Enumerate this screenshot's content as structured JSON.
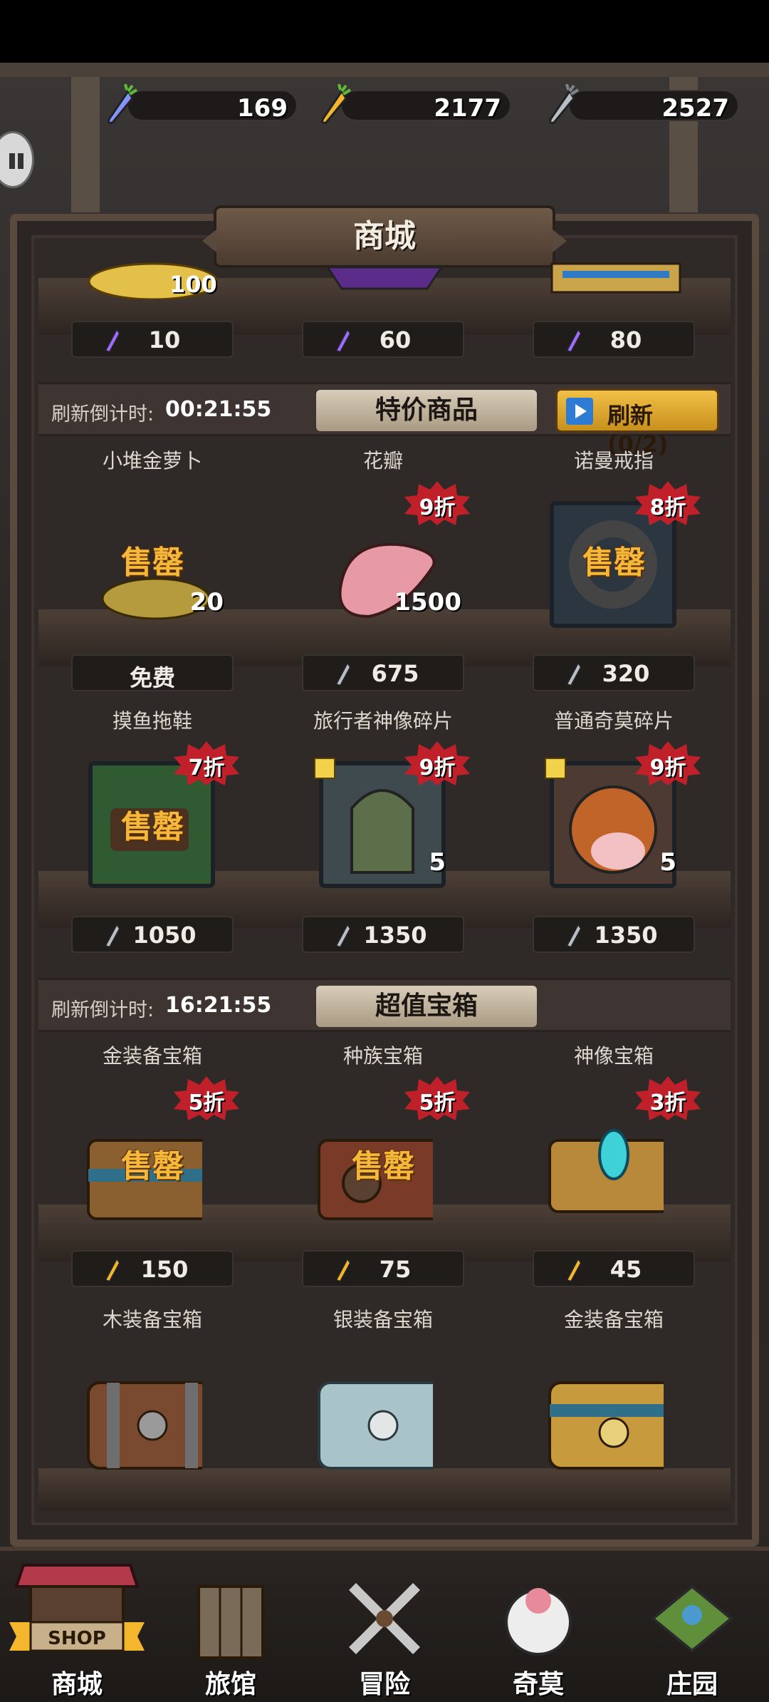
{
  "currencies": [
    {
      "name": "rainbow-carrot",
      "value": "169"
    },
    {
      "name": "gold-carrot",
      "value": "2177"
    },
    {
      "name": "silver-carrot",
      "value": "2527"
    }
  ],
  "page_title": "商城",
  "top_row_prices": [
    {
      "currency": "rainbow-carrot",
      "price": "10",
      "count": "100"
    },
    {
      "currency": "rainbow-carrot",
      "price": "60"
    },
    {
      "currency": "rainbow-carrot",
      "price": "80"
    }
  ],
  "special": {
    "timer_label": "刷新倒计时:",
    "timer": "00:21:55",
    "title": "特价商品",
    "refresh_label": "刷新 (0/2)",
    "rows": [
      [
        {
          "name": "小堆金萝卜",
          "sold": "售罄",
          "count": "20",
          "price": "免费",
          "currency": "none"
        },
        {
          "name": "花瓣",
          "discount": "9折",
          "count": "1500",
          "price": "675",
          "currency": "silver-carrot"
        },
        {
          "name": "诺曼戒指",
          "discount": "8折",
          "sold": "售罄",
          "price": "320",
          "currency": "silver-carrot"
        }
      ],
      [
        {
          "name": "摸鱼拖鞋",
          "discount": "7折",
          "sold": "售罄",
          "price": "1050",
          "currency": "silver-carrot"
        },
        {
          "name": "旅行者神像碎片",
          "discount": "9折",
          "count": "5",
          "price": "1350",
          "currency": "silver-carrot"
        },
        {
          "name": "普通奇莫碎片",
          "discount": "9折",
          "count": "5",
          "price": "1350",
          "currency": "silver-carrot"
        }
      ]
    ]
  },
  "chests": {
    "timer_label": "刷新倒计时:",
    "timer": "16:21:55",
    "title": "超值宝箱",
    "rows": [
      [
        {
          "name": "金装备宝箱",
          "discount": "5折",
          "sold": "售罄",
          "price": "150",
          "currency": "gold-carrot"
        },
        {
          "name": "种族宝箱",
          "discount": "5折",
          "sold": "售罄",
          "price": "75",
          "currency": "gold-carrot"
        },
        {
          "name": "神像宝箱",
          "discount": "3折",
          "price": "45",
          "currency": "gold-carrot"
        }
      ],
      [
        {
          "name": "木装备宝箱"
        },
        {
          "name": "银装备宝箱"
        },
        {
          "name": "金装备宝箱"
        }
      ]
    ]
  },
  "tabs": [
    {
      "label": "商城",
      "active": true,
      "shop_sign": "SHOP"
    },
    {
      "label": "旅馆"
    },
    {
      "label": "冒险"
    },
    {
      "label": "奇莫"
    },
    {
      "label": "庄园"
    }
  ],
  "colors": {
    "sold_out": "#f6b83a",
    "discount_badge": "#c0202a",
    "refresh_button": "#f1c046"
  }
}
